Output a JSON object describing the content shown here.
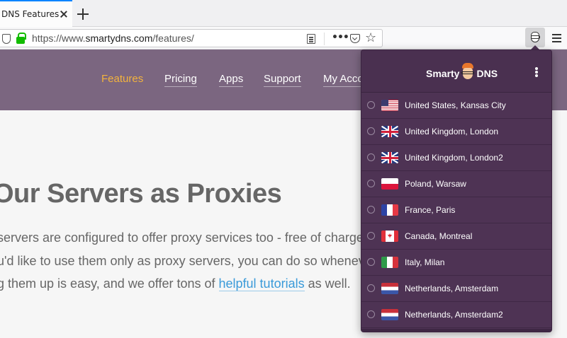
{
  "browser": {
    "tab": {
      "title": "DNS Features |"
    },
    "url": {
      "prefix": "https://www.",
      "domain": "smartydns.com",
      "path": "/features/"
    }
  },
  "site": {
    "nav": [
      {
        "label": "Features",
        "active": true
      },
      {
        "label": "Pricing",
        "active": false
      },
      {
        "label": "Apps",
        "active": false
      },
      {
        "label": "Support",
        "active": false
      },
      {
        "label": "My Acco",
        "active": false
      }
    ],
    "headline": "Our Servers as Proxies",
    "paragraph": {
      "line1": "servers are configured to offer proxy services too - free of charge",
      "line2": "u'd like to use them only as proxy servers, you can do so whenever",
      "line3_before": "g them up is easy, and we offer tons of ",
      "line3_link": "helpful tutorials",
      "line3_after": " as well."
    }
  },
  "extension": {
    "brand": {
      "left": "Smarty",
      "right": "DNS"
    },
    "servers": [
      {
        "name": "United States, Kansas City",
        "flag": "us"
      },
      {
        "name": "United Kingdom, London",
        "flag": "uk"
      },
      {
        "name": "United Kingdom, London2",
        "flag": "uk"
      },
      {
        "name": "Poland, Warsaw",
        "flag": "pl"
      },
      {
        "name": "France, Paris",
        "flag": "fr"
      },
      {
        "name": "Canada, Montreal",
        "flag": "ca"
      },
      {
        "name": "Italy, Milan",
        "flag": "it"
      },
      {
        "name": "Netherlands, Amsterdam",
        "flag": "nl"
      },
      {
        "name": "Netherlands, Amsterdam2",
        "flag": "nl"
      }
    ]
  },
  "colors": {
    "accent": "#f3b33d",
    "site_nav_bg": "#7b6680",
    "popup_bg": "#4e3354",
    "link": "#3a9ad9"
  }
}
